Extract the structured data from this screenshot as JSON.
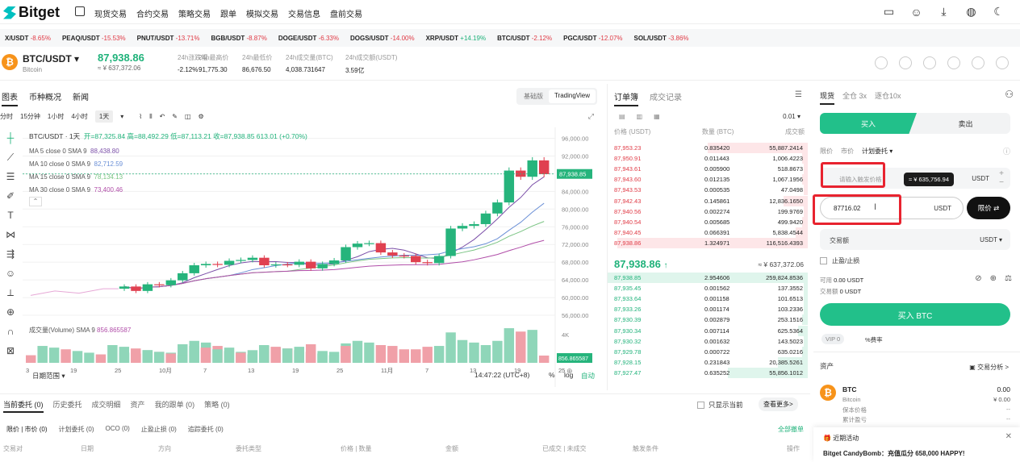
{
  "nav": {
    "logo": "Bitget",
    "items": [
      "现货交易",
      "合约交易",
      "策略交易",
      "跟单",
      "模拟交易",
      "交易信息",
      "盘前交易"
    ],
    "icons": [
      "wallet-icon",
      "user-icon",
      "download-icon",
      "globe-icon",
      "moon-icon"
    ]
  },
  "ticker": [
    {
      "pair": "X/USDT",
      "chg": "-8.65%",
      "dir": "neg"
    },
    {
      "pair": "PEAQ/USDT",
      "chg": "-15.53%",
      "dir": "neg"
    },
    {
      "pair": "PNUT/USDT",
      "chg": "-13.71%",
      "dir": "neg"
    },
    {
      "pair": "BGB/USDT",
      "chg": "-8.87%",
      "dir": "neg"
    },
    {
      "pair": "DOGE/USDT",
      "chg": "-6.33%",
      "dir": "neg"
    },
    {
      "pair": "DOGS/USDT",
      "chg": "-14.00%",
      "dir": "neg"
    },
    {
      "pair": "XRP/USDT",
      "chg": "+14.19%",
      "dir": "pos"
    },
    {
      "pair": "BTC/USDT",
      "chg": "-2.12%",
      "dir": "neg"
    },
    {
      "pair": "PGC/USDT",
      "chg": "-12.07%",
      "dir": "neg"
    },
    {
      "pair": "SOL/USDT",
      "chg": "-3.86%",
      "dir": "neg"
    }
  ],
  "header": {
    "pair": "BTC/USDT",
    "coin": "Bitcoin",
    "price": "87,938.86",
    "price_sub": "≈ ¥ 637,372.06",
    "stats": [
      {
        "label": "24h涨跌幅",
        "value": "-2.12%",
        "dir": "neg"
      },
      {
        "label": "24h最高价",
        "value": "91,775.30",
        "dir": ""
      },
      {
        "label": "24h最低价",
        "value": "86,676.50",
        "dir": ""
      },
      {
        "label": "24h成交量(BTC)",
        "value": "4,038.731647",
        "dir": ""
      },
      {
        "label": "24h成交额(USDT)",
        "value": "3.59亿",
        "dir": ""
      }
    ]
  },
  "chart": {
    "tabs": [
      "图表",
      "币种概况",
      "新闻"
    ],
    "view_modes": [
      "基础版",
      "TradingView"
    ],
    "intervals": [
      "分时",
      "15分钟",
      "1小时",
      "4小时",
      "1天"
    ],
    "legend_title": "BTC/USDT · 1天",
    "ohlc": "开=87,325.84 高=88,492.29 低=87,113.21 收=87,938.85 613.01 (+0.70%)",
    "ma_lines": [
      {
        "label": "MA 5 close 0 SMA 9",
        "value": "88,438.80",
        "color": "#7b4fa8"
      },
      {
        "label": "MA 10 close 0 SMA 9",
        "value": "82,712.59",
        "color": "#6a8fd6"
      },
      {
        "label": "MA 15 close 0 SMA 9",
        "value": "78,134.13",
        "color": "#7ac483"
      },
      {
        "label": "MA 30 close 0 SMA 9",
        "value": "73,400.46",
        "color": "#b04da8"
      }
    ],
    "volume_label": "成交量(Volume) SMA 9",
    "volume_value": "856.865587",
    "vol_axis_4k": "4K",
    "price_axis": [
      "96,000.00",
      "92,000.00",
      "88,000.00",
      "84,000.00",
      "80,000.00",
      "76,000.00",
      "72,000.00",
      "68,000.00",
      "64,000.00",
      "60,000.00",
      "56,000.00"
    ],
    "last_price_tag": "87,938.85",
    "last_vol_tag": "856.865587",
    "dates": [
      "3",
      "19",
      "25",
      "10月",
      "7",
      "13",
      "19",
      "25",
      "11月",
      "7",
      "13",
      "19",
      "25"
    ],
    "range_label": "日期范围",
    "time": "14:47:22 (UTC+8)",
    "opts": [
      "%",
      "log",
      "自动"
    ]
  },
  "chart_data": {
    "type": "candlestick",
    "x": [
      "10-09",
      "10-10",
      "10-11",
      "10-12",
      "10-13",
      "10-14",
      "10-15",
      "10-16",
      "10-17",
      "10-18",
      "10-19",
      "10-20",
      "10-21",
      "10-22",
      "10-23",
      "10-24",
      "10-25",
      "10-26",
      "10-27",
      "10-28",
      "10-29",
      "10-30",
      "10-31",
      "11-01",
      "11-02",
      "11-03",
      "11-04",
      "11-05",
      "11-06",
      "11-07",
      "11-08",
      "11-09",
      "11-10",
      "11-11",
      "11-12",
      "11-13",
      "11-14"
    ],
    "open": [
      62000,
      62500,
      61500,
      63000,
      62800,
      63900,
      65500,
      67300,
      67600,
      67400,
      68300,
      68500,
      69000,
      67300,
      67500,
      67400,
      68100,
      66600,
      67600,
      68400,
      71400,
      72200,
      72300,
      70200,
      69500,
      69400,
      68000,
      67800,
      69400,
      75600,
      76200,
      76600,
      79000,
      81500,
      88700,
      87300,
      91000
    ],
    "close": [
      62500,
      61500,
      63000,
      62800,
      63900,
      65500,
      67300,
      67600,
      67400,
      68300,
      68500,
      69000,
      67300,
      67500,
      67400,
      68100,
      66600,
      67600,
      68400,
      71400,
      72200,
      72300,
      70200,
      69500,
      69400,
      68000,
      67800,
      69400,
      75600,
      76200,
      76600,
      79000,
      81500,
      88700,
      87300,
      91000,
      87900
    ],
    "volume": [
      1.2,
      1.1,
      1.5,
      1.3,
      1.2,
      2.2,
      2.6,
      2.4,
      2.0,
      1.8,
      1.3,
      1.5,
      2.0,
      1.8,
      1.7,
      1.9,
      2.2,
      1.4,
      1.3,
      2.3,
      2.6,
      2.4,
      2.1,
      2.0,
      1.6,
      1.6,
      1.9,
      2.0,
      3.6,
      2.7,
      2.4,
      2.1,
      2.6,
      4.1,
      3.7,
      3.9,
      0.86
    ],
    "ylim": [
      54000,
      97000
    ]
  },
  "orderbook": {
    "tabs": [
      "订单簿",
      "成交记录"
    ],
    "precision": "0.01",
    "headers": [
      "价格 (USDT)",
      "数量 (BTC)",
      "成交额"
    ],
    "asks": [
      [
        "87,953.23",
        "0.835420",
        "55,887.2414"
      ],
      [
        "87,950.91",
        "0.011443",
        "1,006.4223"
      ],
      [
        "87,943.61",
        "0.005900",
        "518.8673"
      ],
      [
        "87,943.60",
        "0.012135",
        "1,067.1956"
      ],
      [
        "87,943.53",
        "0.000535",
        "47.0498"
      ],
      [
        "87,942.43",
        "0.145861",
        "12,836.1650"
      ],
      [
        "87,940.56",
        "0.002274",
        "199.9769"
      ],
      [
        "87,940.54",
        "0.005685",
        "499.9420"
      ],
      [
        "87,940.45",
        "0.066391",
        "5,838.4544"
      ],
      [
        "87,938.86",
        "1.324971",
        "116,516.4393"
      ]
    ],
    "ask_depth": [
      0.5,
      0.03,
      0.02,
      0.03,
      0.02,
      0.12,
      0.02,
      0.03,
      0.06,
      0.95
    ],
    "mid": "87,938.86",
    "mid_arrow": "↑",
    "mid_sub": "≈ ¥ 637,372.06",
    "bids": [
      [
        "87,938.85",
        "2.954606",
        "259,824.8536"
      ],
      [
        "87,935.45",
        "0.001562",
        "137.3552"
      ],
      [
        "87,933.64",
        "0.001158",
        "101.6513"
      ],
      [
        "87,933.26",
        "0.001174",
        "103.2336"
      ],
      [
        "87,930.39",
        "0.002879",
        "253.1516"
      ],
      [
        "87,930.34",
        "0.007114",
        "625.5364"
      ],
      [
        "87,930.32",
        "0.001632",
        "143.5023"
      ],
      [
        "87,929.78",
        "0.000722",
        "635.0216"
      ],
      [
        "87,928.15",
        "0.231843",
        "20,385.5261"
      ],
      [
        "87,927.47",
        "0.635252",
        "55,856.1012"
      ]
    ],
    "bid_depth": [
      1.0,
      0.02,
      0.02,
      0.02,
      0.03,
      0.05,
      0.02,
      0.03,
      0.15,
      0.4
    ]
  },
  "trade": {
    "tabs": [
      "现货",
      "全仓 3x",
      "逐仓10x"
    ],
    "buy": "买入",
    "sell": "卖出",
    "order_types": [
      "限价",
      "市价",
      "计划委托 ▾"
    ],
    "trigger_placeholder": "请输入触发价格",
    "usdt": "USDT",
    "tooltip": "≈ ¥ 635,756.94",
    "price_value": "87716.02",
    "limit_btn": "限价 ⇄",
    "amount_label": "交易额",
    "amount_unit": "USDT ▾",
    "tpsl": "止盈/止损",
    "avail": "可用",
    "avail_val": "0.00 USDT",
    "vol_label": "交易额",
    "vol_val": "0 USDT",
    "buy_btc": "买入 BTC",
    "vip": "VIP 0",
    "fee": "%费率",
    "assets": "资产",
    "trade_analysis": "交易分析 >",
    "asset_name": "BTC",
    "asset_sub": "Bitcoin",
    "asset_val": "0.00",
    "asset_cny": "¥ 0.00",
    "deposit": "保本价格",
    "cost": "累计盈亏",
    "dash": "--",
    "promo_title": "近期活动",
    "promo": "Bitget CandyBomb：充值瓜分 658,000 HAPPY!"
  },
  "bottom": {
    "tabs": [
      "当前委托 (0)",
      "历史委托",
      "成交明细",
      "资产",
      "我的跟单 (0)",
      "策略 (0)"
    ],
    "only_current": "只显示当前",
    "more": "查看更多>",
    "subtabs": [
      "限价 | 市价 (0)",
      "计划委托 (0)",
      "OCO (0)",
      "止盈止损 (0)",
      "追踪委托 (0)"
    ],
    "cancel_all": "全部撤单",
    "cols": [
      "交易对",
      "日期",
      "方向",
      "委托类型",
      "价格 | 数量",
      "金额",
      "已成交 | 未成交",
      "触发条件",
      "操作"
    ]
  }
}
